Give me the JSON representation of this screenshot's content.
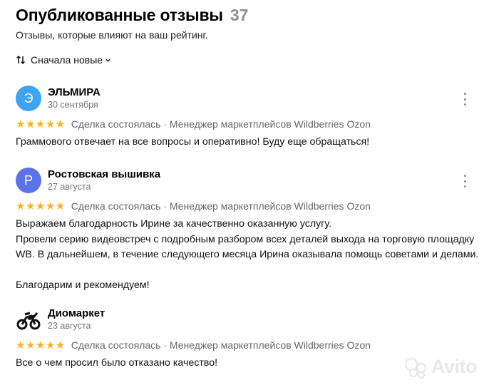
{
  "header": {
    "title": "Опубликованные отзывы",
    "count": "37",
    "subtitle": "Отзывы, которые влияют на ваш рейтинг."
  },
  "sort": {
    "label": "Сначала новые"
  },
  "reviews": [
    {
      "avatar_letter": "Э",
      "avatar_color": "#3ea3f1",
      "name": "ЭЛЬМИРА",
      "date": "30 сентября",
      "rating": 5,
      "stars": "★★★★★",
      "meta": "Сделка состоялась · Менеджер маркетплейсов Wildberries Ozon",
      "text": "Граммового отвечает на все вопросы и оперативно! Буду еще обращаться!"
    },
    {
      "avatar_letter": "Р",
      "avatar_color": "#5a73e8",
      "name": "Ростовская вышивка",
      "date": "27 августа",
      "rating": 5,
      "stars": "★★★★★",
      "meta": "Сделка состоялась · Менеджер маркетплейсов Wildberries Ozon",
      "text": "Выражаем благодарность Ирине за качественно оказанную услугу.\nПровели серию видеовстреч с подробным разбором всех деталей выхода на торговую площадку WB. В дальнейшем, в течение следующего месяца Ирина оказывала помощь советами и делами.\n\nБлагодарим и рекомендуем!"
    },
    {
      "avatar_letter": "",
      "avatar_color": "#ffffff",
      "name": "Диомаркет",
      "date": "23 августа",
      "rating": 5,
      "stars": "★★★★★",
      "meta": "Сделка состоялась · Менеджер маркетплейсов Wildberries Ozon",
      "text": "Все о чем просил было отказано качество!"
    }
  ],
  "watermark": {
    "text": "Avito"
  },
  "colors": {
    "star": "#ffb021",
    "muted": "#757575"
  }
}
